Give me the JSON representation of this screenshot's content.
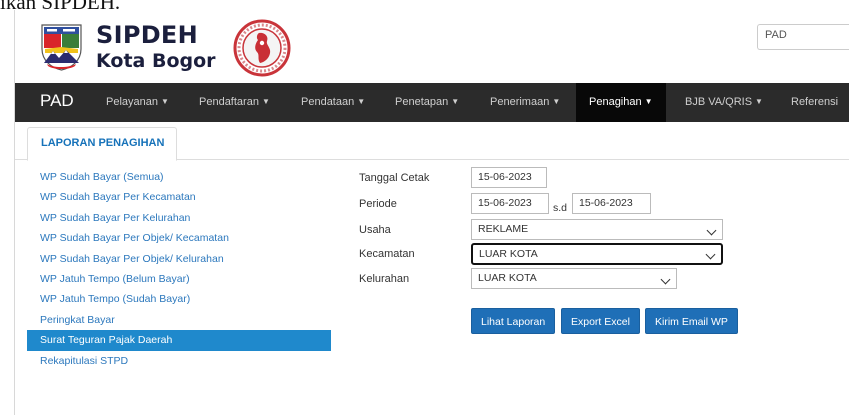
{
  "top_fragment": "ikan SIPDEH.",
  "header": {
    "title": "SIPDEH",
    "subtitle": "Kota Bogor",
    "pad_select_value": "PAD"
  },
  "navbar": {
    "brand": "PAD",
    "items": [
      {
        "label": "Pelayanan"
      },
      {
        "label": "Pendaftaran"
      },
      {
        "label": "Pendataan"
      },
      {
        "label": "Penetapan"
      },
      {
        "label": "Penerimaan"
      },
      {
        "label": "Penagihan"
      },
      {
        "label": "BJB VA/QRIS"
      },
      {
        "label": "Referensi"
      }
    ]
  },
  "tab": {
    "label": "LAPORAN PENAGIHAN"
  },
  "menu": {
    "items": [
      {
        "label": "WP Sudah Bayar (Semua)"
      },
      {
        "label": "WP Sudah Bayar Per Kecamatan"
      },
      {
        "label": "WP Sudah Bayar Per Kelurahan"
      },
      {
        "label": "WP Sudah Bayar Per Objek/ Kecamatan"
      },
      {
        "label": "WP Sudah Bayar Per Objek/ Kelurahan"
      },
      {
        "label": "WP Jatuh Tempo (Belum Bayar)"
      },
      {
        "label": "WP Jatuh Tempo (Sudah Bayar)"
      },
      {
        "label": "Peringkat Bayar"
      },
      {
        "label": "Surat Teguran Pajak Daerah"
      },
      {
        "label": "Rekapitulasi STPD"
      }
    ]
  },
  "form": {
    "tanggal_cetak": {
      "label": "Tanggal Cetak",
      "value": "15-06-2023"
    },
    "periode": {
      "label": "Periode",
      "from": "15-06-2023",
      "sd_label": "s.d",
      "to": "15-06-2023"
    },
    "usaha": {
      "label": "Usaha",
      "value": "REKLAME"
    },
    "kecamatan": {
      "label": "Kecamatan",
      "value": "LUAR KOTA"
    },
    "kelurahan": {
      "label": "Kelurahan",
      "value": "LUAR KOTA"
    }
  },
  "buttons": {
    "lihat": "Lihat Laporan",
    "export": "Export Excel",
    "email": "Kirim Email WP"
  },
  "colors": {
    "navbar_bg": "#2b2b2b",
    "accent_blue": "#1f89cc",
    "button_blue": "#1f6fb7",
    "link_blue": "#2c78bd"
  }
}
